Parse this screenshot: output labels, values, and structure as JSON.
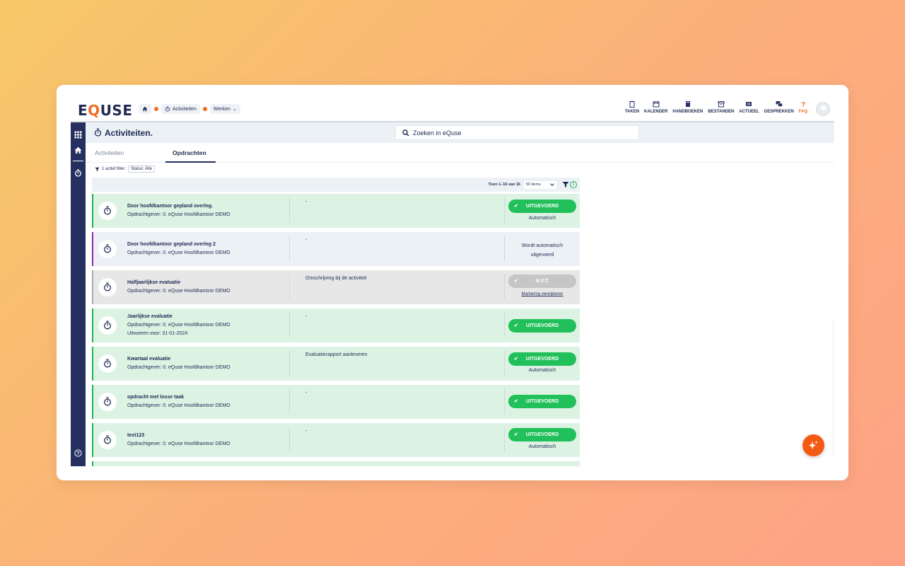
{
  "app": {
    "logo_pre": "E",
    "logo_q": "Q",
    "logo_post": "USE"
  },
  "breadcrumb": {
    "item1": "Activiteiten",
    "item2": "Werken"
  },
  "topnav": [
    {
      "label": "TAKEN",
      "icon": "clipboard-icon"
    },
    {
      "label": "KALENDER",
      "icon": "calendar-icon"
    },
    {
      "label": "HANDBOEKEN",
      "icon": "book-icon"
    },
    {
      "label": "BESTANDEN",
      "icon": "archive-icon"
    },
    {
      "label": "ACTUEEL",
      "icon": "news-icon"
    },
    {
      "label": "GESPREKKEN",
      "icon": "chat-icon"
    },
    {
      "label": "FAQ",
      "icon": "question-icon"
    }
  ],
  "page": {
    "title": "Activiteiten."
  },
  "search": {
    "placeholder": "Zoeken in eQuse"
  },
  "tabs": [
    {
      "label": "Activiteiten"
    },
    {
      "label": "Opdrachten"
    }
  ],
  "filter": {
    "label": "1 actief filter:",
    "pill": "Status: Alle"
  },
  "listbar": {
    "count": "Toon 1–16 van 16",
    "per_page": "50 items",
    "filter_count": "1"
  },
  "rows": [
    {
      "name": "Door hoofdkantoor gepland overleg.",
      "sub": "Opdrachtgever: 0. eQuse Hoofdkantoor DEMO",
      "sub2": "",
      "desc": "-",
      "status": "UITGEVOERD",
      "status_sub": "Automatisch",
      "style": "green"
    },
    {
      "name": "Door hoofdkantoor gepland overleg 2",
      "sub": "Opdrachtgever: 0. eQuse Hoofdkantoor DEMO",
      "sub2": "",
      "desc": "-",
      "status_text1": "Wordt automatisch",
      "status_text2": "uitgevoerd",
      "style": "blue"
    },
    {
      "name": "Halfjaarlijkse evaluatie",
      "sub": "Opdrachtgever: 0. eQuse Hoofdkantoor DEMO",
      "sub2": "",
      "desc": "Omschrijving bij de activiteit",
      "status": "N.V.T.",
      "status_sub": "Markering verwijderen",
      "style": "grey"
    },
    {
      "name": "Jaarlijkse evaluatie",
      "sub": "Opdrachtgever: 0. eQuse Hoofdkantoor DEMO",
      "sub2": "Uitvoeren voor: 31-01-2024",
      "desc": "-",
      "status": "UITGEVOERD",
      "status_sub": "",
      "style": "green"
    },
    {
      "name": "Kwartaal evaluatie",
      "sub": "Opdrachtgever: 0. eQuse Hoofdkantoor DEMO",
      "sub2": "",
      "desc": "Evaluatierapport aanleveren",
      "status": "UITGEVOERD",
      "status_sub": "Automatisch",
      "style": "green"
    },
    {
      "name": "opdracht met losse taak",
      "sub": "Opdrachtgever: 0. eQuse Hoofdkantoor DEMO",
      "sub2": "",
      "desc": "-",
      "status": "UITGEVOERD",
      "status_sub": "",
      "style": "green"
    },
    {
      "name": "test123",
      "sub": "Opdrachtgever: 0. eQuse Hoofdkantoor DEMO",
      "sub2": "",
      "desc": "-",
      "status": "UITGEVOERD",
      "status_sub": "Automatisch",
      "style": "green"
    }
  ],
  "colors": {
    "navy": "#253060",
    "green": "#21c05a",
    "orange": "#f36b21"
  }
}
